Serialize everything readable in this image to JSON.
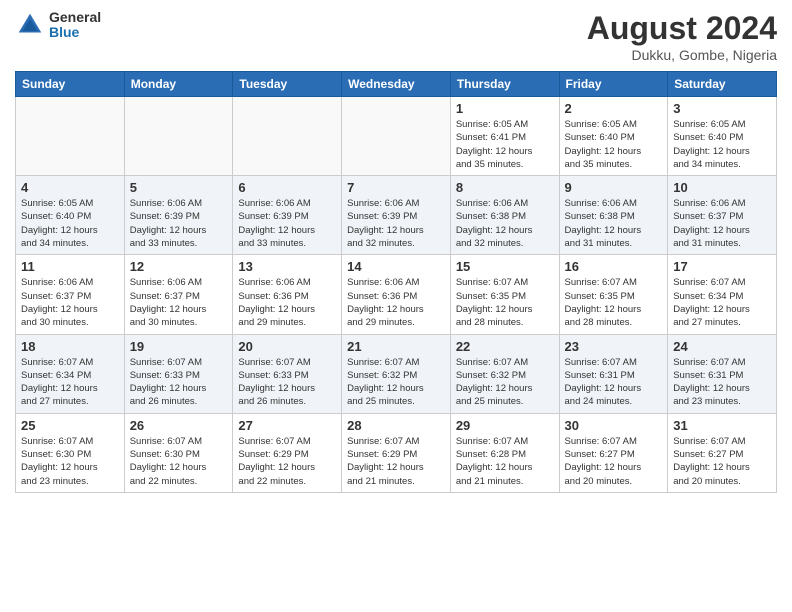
{
  "logo": {
    "general": "General",
    "blue": "Blue"
  },
  "title": "August 2024",
  "location": "Dukku, Gombe, Nigeria",
  "days_of_week": [
    "Sunday",
    "Monday",
    "Tuesday",
    "Wednesday",
    "Thursday",
    "Friday",
    "Saturday"
  ],
  "weeks": [
    [
      {
        "day": "",
        "info": ""
      },
      {
        "day": "",
        "info": ""
      },
      {
        "day": "",
        "info": ""
      },
      {
        "day": "",
        "info": ""
      },
      {
        "day": "1",
        "info": "Sunrise: 6:05 AM\nSunset: 6:41 PM\nDaylight: 12 hours\nand 35 minutes."
      },
      {
        "day": "2",
        "info": "Sunrise: 6:05 AM\nSunset: 6:40 PM\nDaylight: 12 hours\nand 35 minutes."
      },
      {
        "day": "3",
        "info": "Sunrise: 6:05 AM\nSunset: 6:40 PM\nDaylight: 12 hours\nand 34 minutes."
      }
    ],
    [
      {
        "day": "4",
        "info": "Sunrise: 6:05 AM\nSunset: 6:40 PM\nDaylight: 12 hours\nand 34 minutes."
      },
      {
        "day": "5",
        "info": "Sunrise: 6:06 AM\nSunset: 6:39 PM\nDaylight: 12 hours\nand 33 minutes."
      },
      {
        "day": "6",
        "info": "Sunrise: 6:06 AM\nSunset: 6:39 PM\nDaylight: 12 hours\nand 33 minutes."
      },
      {
        "day": "7",
        "info": "Sunrise: 6:06 AM\nSunset: 6:39 PM\nDaylight: 12 hours\nand 32 minutes."
      },
      {
        "day": "8",
        "info": "Sunrise: 6:06 AM\nSunset: 6:38 PM\nDaylight: 12 hours\nand 32 minutes."
      },
      {
        "day": "9",
        "info": "Sunrise: 6:06 AM\nSunset: 6:38 PM\nDaylight: 12 hours\nand 31 minutes."
      },
      {
        "day": "10",
        "info": "Sunrise: 6:06 AM\nSunset: 6:37 PM\nDaylight: 12 hours\nand 31 minutes."
      }
    ],
    [
      {
        "day": "11",
        "info": "Sunrise: 6:06 AM\nSunset: 6:37 PM\nDaylight: 12 hours\nand 30 minutes."
      },
      {
        "day": "12",
        "info": "Sunrise: 6:06 AM\nSunset: 6:37 PM\nDaylight: 12 hours\nand 30 minutes."
      },
      {
        "day": "13",
        "info": "Sunrise: 6:06 AM\nSunset: 6:36 PM\nDaylight: 12 hours\nand 29 minutes."
      },
      {
        "day": "14",
        "info": "Sunrise: 6:06 AM\nSunset: 6:36 PM\nDaylight: 12 hours\nand 29 minutes."
      },
      {
        "day": "15",
        "info": "Sunrise: 6:07 AM\nSunset: 6:35 PM\nDaylight: 12 hours\nand 28 minutes."
      },
      {
        "day": "16",
        "info": "Sunrise: 6:07 AM\nSunset: 6:35 PM\nDaylight: 12 hours\nand 28 minutes."
      },
      {
        "day": "17",
        "info": "Sunrise: 6:07 AM\nSunset: 6:34 PM\nDaylight: 12 hours\nand 27 minutes."
      }
    ],
    [
      {
        "day": "18",
        "info": "Sunrise: 6:07 AM\nSunset: 6:34 PM\nDaylight: 12 hours\nand 27 minutes."
      },
      {
        "day": "19",
        "info": "Sunrise: 6:07 AM\nSunset: 6:33 PM\nDaylight: 12 hours\nand 26 minutes."
      },
      {
        "day": "20",
        "info": "Sunrise: 6:07 AM\nSunset: 6:33 PM\nDaylight: 12 hours\nand 26 minutes."
      },
      {
        "day": "21",
        "info": "Sunrise: 6:07 AM\nSunset: 6:32 PM\nDaylight: 12 hours\nand 25 minutes."
      },
      {
        "day": "22",
        "info": "Sunrise: 6:07 AM\nSunset: 6:32 PM\nDaylight: 12 hours\nand 25 minutes."
      },
      {
        "day": "23",
        "info": "Sunrise: 6:07 AM\nSunset: 6:31 PM\nDaylight: 12 hours\nand 24 minutes."
      },
      {
        "day": "24",
        "info": "Sunrise: 6:07 AM\nSunset: 6:31 PM\nDaylight: 12 hours\nand 23 minutes."
      }
    ],
    [
      {
        "day": "25",
        "info": "Sunrise: 6:07 AM\nSunset: 6:30 PM\nDaylight: 12 hours\nand 23 minutes."
      },
      {
        "day": "26",
        "info": "Sunrise: 6:07 AM\nSunset: 6:30 PM\nDaylight: 12 hours\nand 22 minutes."
      },
      {
        "day": "27",
        "info": "Sunrise: 6:07 AM\nSunset: 6:29 PM\nDaylight: 12 hours\nand 22 minutes."
      },
      {
        "day": "28",
        "info": "Sunrise: 6:07 AM\nSunset: 6:29 PM\nDaylight: 12 hours\nand 21 minutes."
      },
      {
        "day": "29",
        "info": "Sunrise: 6:07 AM\nSunset: 6:28 PM\nDaylight: 12 hours\nand 21 minutes."
      },
      {
        "day": "30",
        "info": "Sunrise: 6:07 AM\nSunset: 6:27 PM\nDaylight: 12 hours\nand 20 minutes."
      },
      {
        "day": "31",
        "info": "Sunrise: 6:07 AM\nSunset: 6:27 PM\nDaylight: 12 hours\nand 20 minutes."
      }
    ]
  ]
}
